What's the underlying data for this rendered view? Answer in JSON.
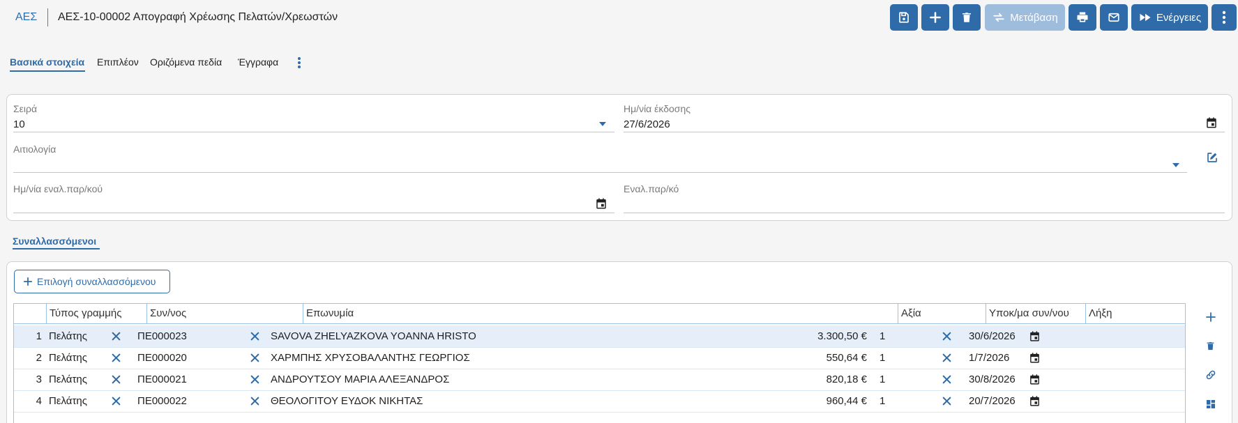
{
  "header": {
    "app_code": "ΑΕΣ",
    "title": "ΑΕΣ-10-00002 Απογραφή Χρέωσης Πελατών/Χρεωστών"
  },
  "toolbar": {
    "save_icon": "save-icon",
    "add_icon": "plus-icon",
    "delete_icon": "trash-icon",
    "transfer_label": "Μετάβαση",
    "print_icon": "print-icon",
    "email_icon": "email-icon",
    "actions_label": "Ενέργειες",
    "more_icon": "more-vertical-icon"
  },
  "tabs": [
    {
      "label": "Βασικά στοιχεία",
      "active": true
    },
    {
      "label": "Επιπλέον"
    },
    {
      "label": "Οριζόμενα πεδία"
    },
    {
      "label": "Έγγραφα"
    }
  ],
  "form": {
    "series_label": "Σειρά",
    "series_value": "10",
    "issue_date_label": "Ημ/νία έκδοσης",
    "issue_date_value": "27/6/2026",
    "reason_label": "Αιτιολογία",
    "reason_value": "",
    "alt_doc_date_label": "Ημ/νία εναλ.παρ/κού",
    "alt_doc_date_value": "",
    "alt_doc_label": "Εναλ.παρ/κό",
    "alt_doc_value": ""
  },
  "section": {
    "title": "Συναλλασσόμενοι",
    "add_button_label": "Επιλογή συναλλασσόμενου"
  },
  "grid": {
    "columns": [
      "Τύπος γραμμής",
      "Συν/νος",
      "Επωνυμία",
      "Αξία",
      "Υποκ/μα συν/νου",
      "Λήξη"
    ],
    "rows": [
      {
        "num": "1",
        "type": "Πελάτης",
        "code": "ΠΕ000023",
        "name": "SAVOVA ZHELYAZKOVA YOANNA HRISTO",
        "amount": "3.300,50 €",
        "branch": "1",
        "due": "30/6/2026",
        "selected": true
      },
      {
        "num": "2",
        "type": "Πελάτης",
        "code": "ΠΕ000020",
        "name": "ΧΑΡΜΠΗΣ ΧΡΥΣΟΒΑΛΑΝΤΗΣ ΓΕΩΡΓΙΟΣ",
        "amount": "550,64 €",
        "branch": "1",
        "due": "1/7/2026"
      },
      {
        "num": "3",
        "type": "Πελάτης",
        "code": "ΠΕ000021",
        "name": "ΑΝΔΡΟΥΤΣΟΥ ΜΑΡΙΑ ΑΛΕΞΑΝΔΡΟΣ",
        "amount": "820,18 €",
        "branch": "1",
        "due": "30/8/2026"
      },
      {
        "num": "4",
        "type": "Πελάτης",
        "code": "ΠΕ000022",
        "name": "ΘΕΟΛΟΓΙΤΟΥ ΕΥΔΟΚ ΝΙΚΗΤΑΣ",
        "amount": "960,44 €",
        "branch": "1",
        "due": "20/7/2026"
      }
    ]
  },
  "colors": {
    "accent": "#2f6ba8",
    "accent_disabled": "#9ebcdb",
    "row_selected": "#e6eff9"
  }
}
